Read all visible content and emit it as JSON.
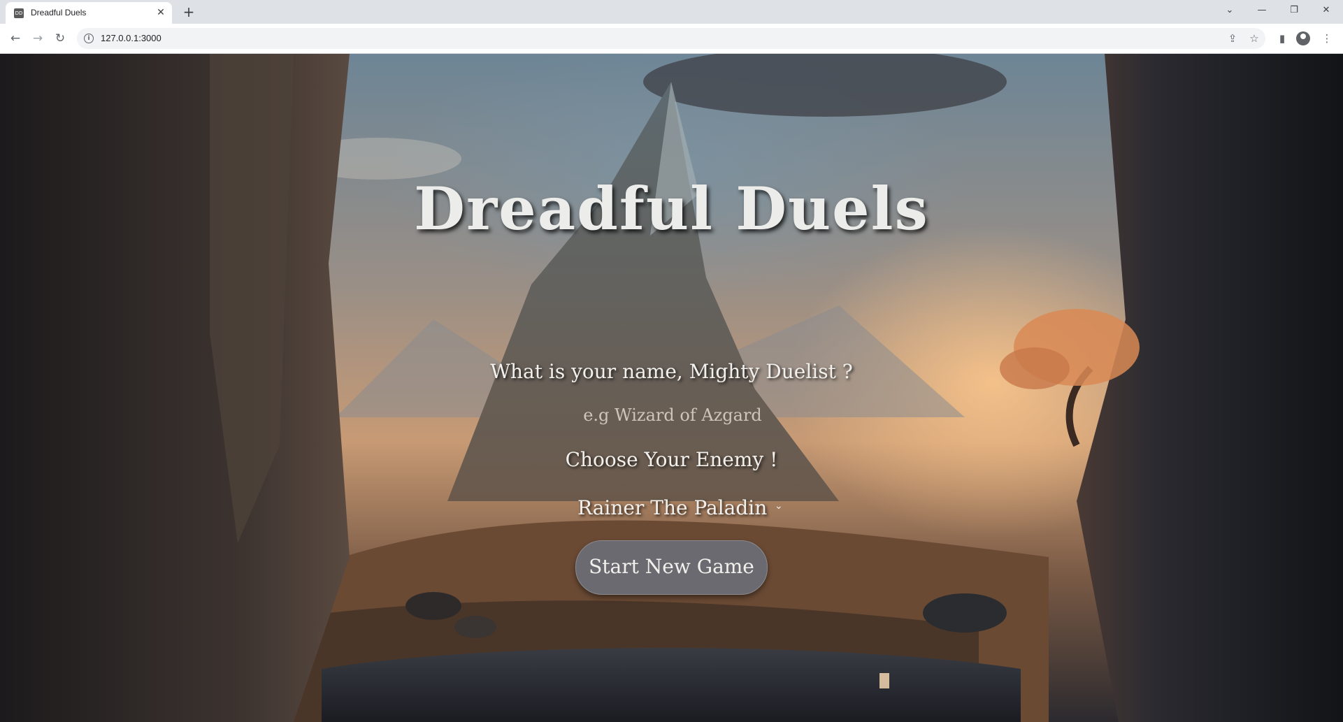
{
  "browser": {
    "tab_title": "Dreadful Duels",
    "tab_favicon_text": "DD",
    "url": "127.0.0.1:3000",
    "icons": {
      "back": "back-arrow-icon",
      "forward": "forward-arrow-icon",
      "reload": "reload-icon",
      "info": "site-info-icon",
      "share": "share-icon",
      "bookmark": "star-icon",
      "sidepanel": "side-panel-icon",
      "profile": "profile-icon",
      "menu": "kebab-menu-icon"
    }
  },
  "game": {
    "title": "Dreadful Duels",
    "name_prompt": "What is your name, Mighty Duelist ?",
    "name_placeholder": "e.g Wizard of Azgard",
    "name_value": "",
    "enemy_prompt": "Choose Your Enemy !",
    "enemy_selected": "Rainer The Paladin",
    "start_button": "Start New Game"
  },
  "colors": {
    "button_bg": "#6b6a70",
    "text": "#f2f0ec"
  }
}
